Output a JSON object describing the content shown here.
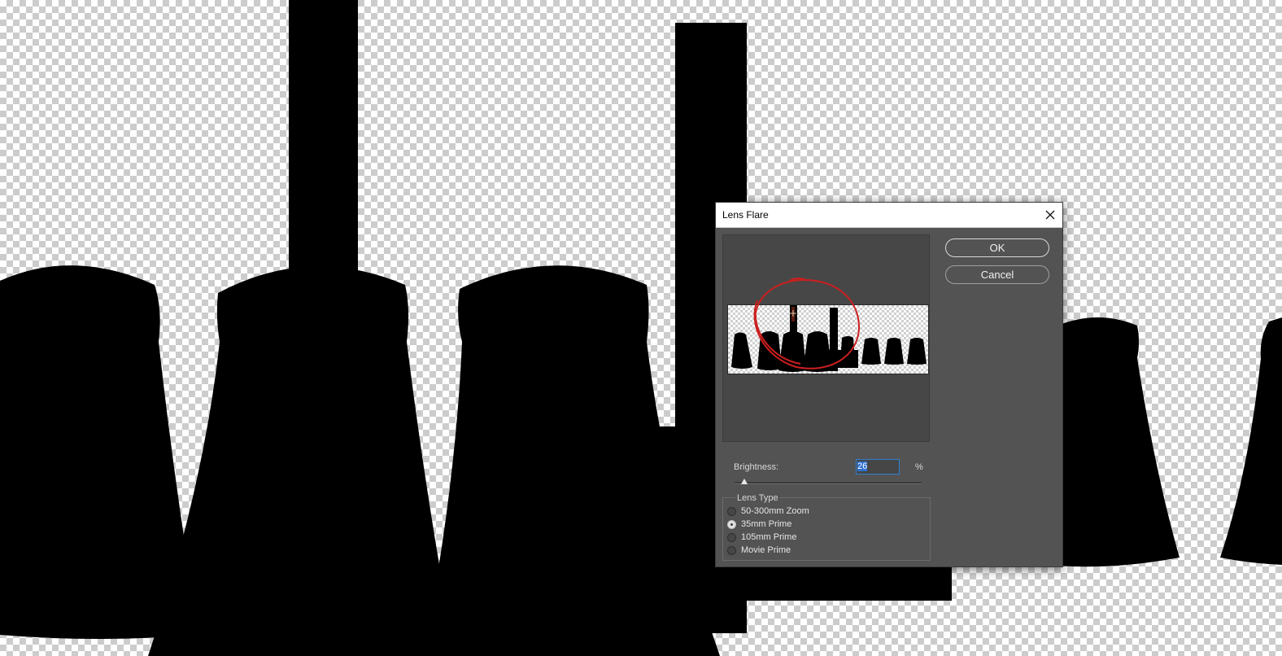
{
  "dialog": {
    "title": "Lens Flare",
    "ok_label": "OK",
    "cancel_label": "Cancel",
    "brightness_label": "Brightness:",
    "brightness_value": "26",
    "brightness_unit": "%",
    "brightness_level_percent": 26,
    "lens_type_legend": "Lens Type",
    "lens_types": [
      {
        "label": "50-300mm Zoom",
        "checked": false
      },
      {
        "label": "35mm Prime",
        "checked": true
      },
      {
        "label": "105mm Prime",
        "checked": false
      },
      {
        "label": "Movie Prime",
        "checked": false
      }
    ]
  },
  "colors": {
    "dialog_bg": "#535353",
    "annotation": "#cc1f1f",
    "selection": "#2f6fd0"
  },
  "icons": {
    "close": "close-icon"
  }
}
